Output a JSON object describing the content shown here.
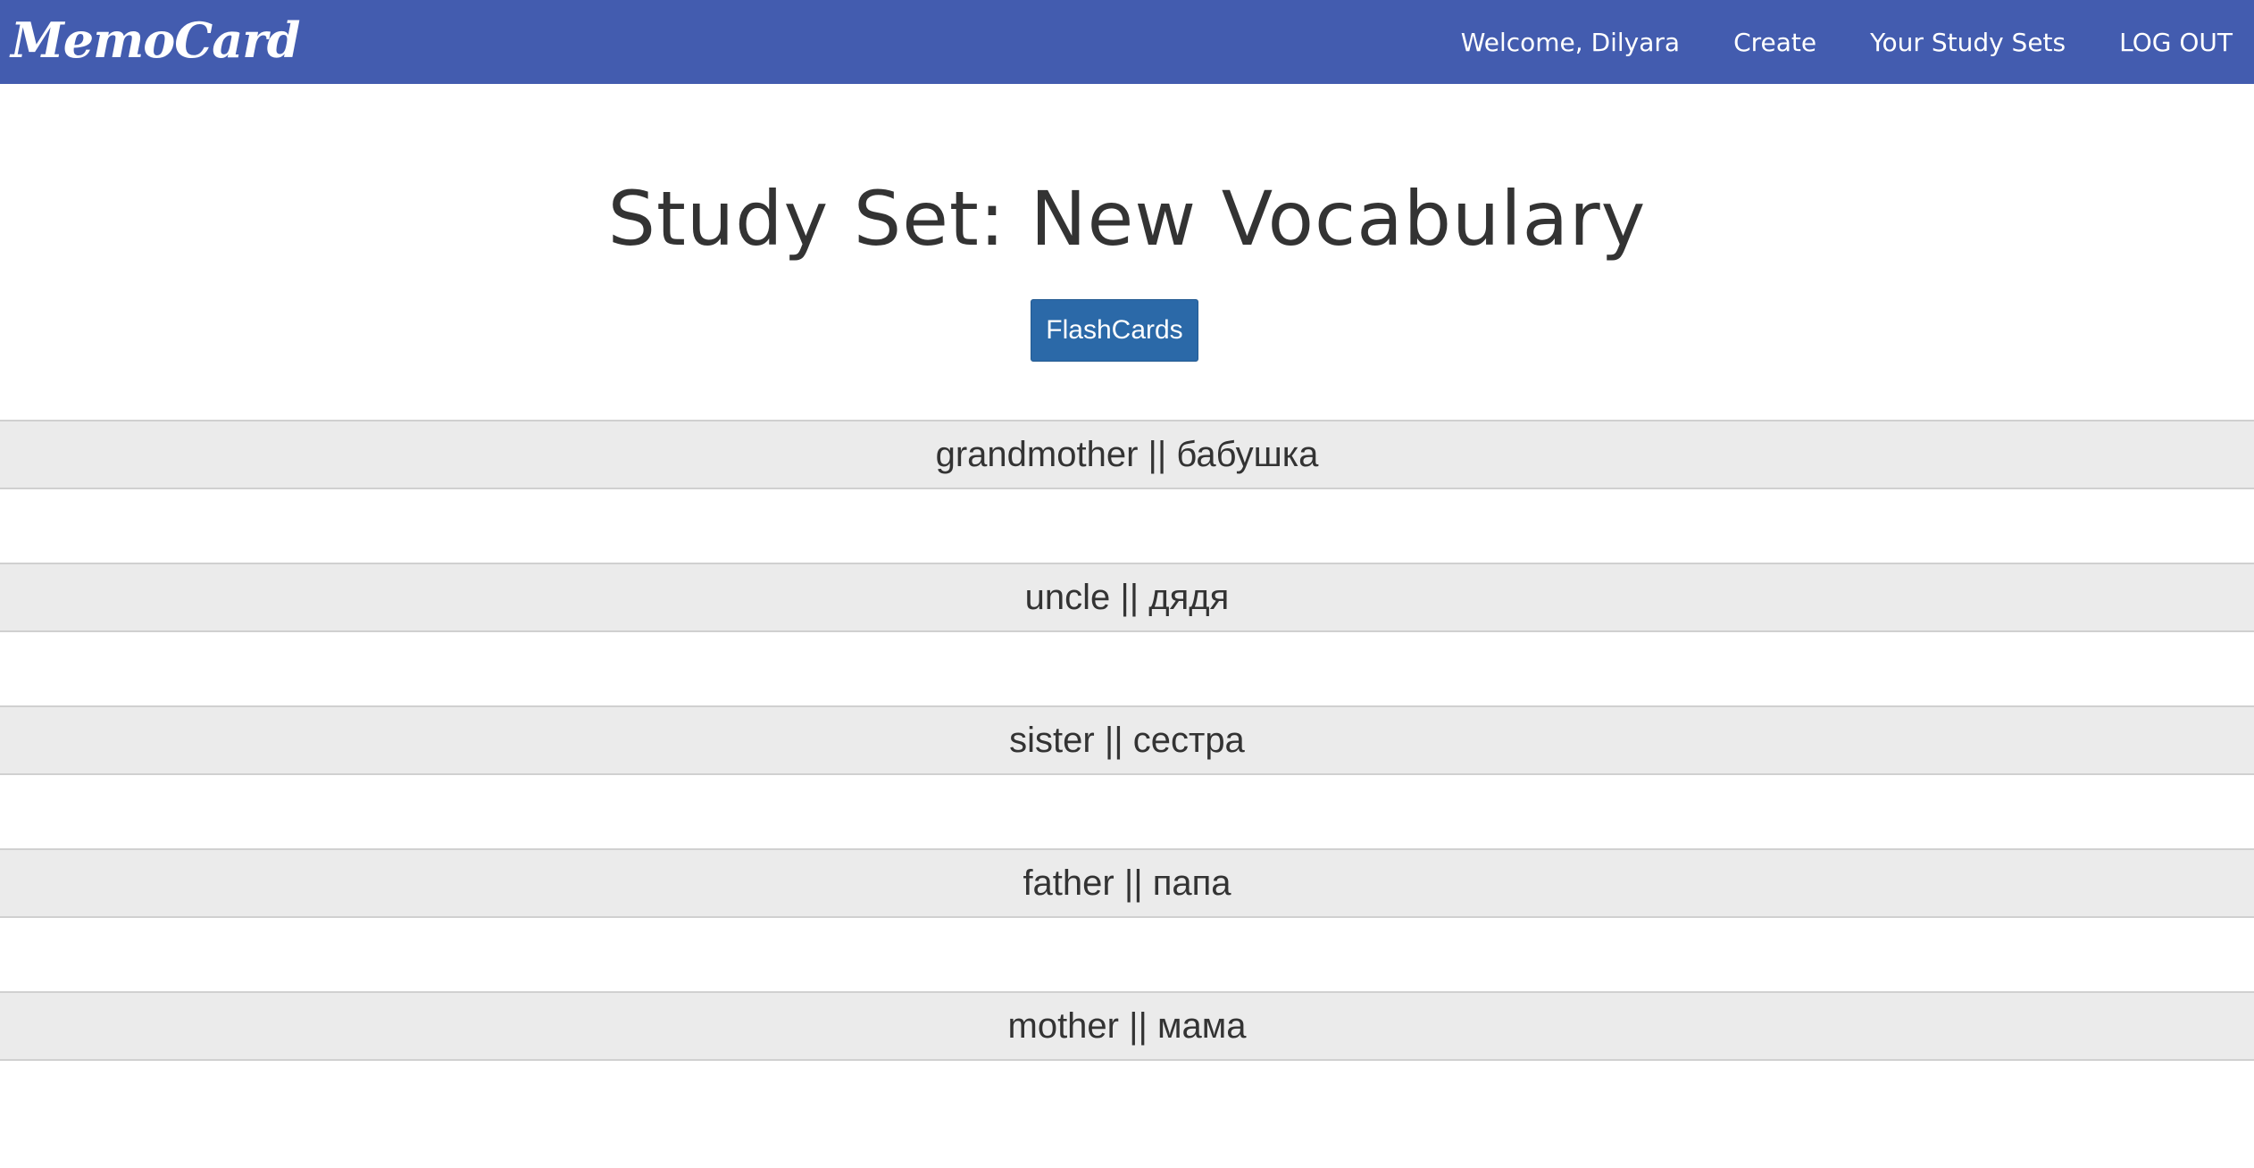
{
  "navbar": {
    "brand": "MemoCard",
    "links": [
      {
        "label": "Welcome, Dilyara"
      },
      {
        "label": "Create"
      },
      {
        "label": "Your Study Sets"
      },
      {
        "label": "LOG OUT"
      }
    ],
    "background_color": "#435caf"
  },
  "main": {
    "title": "Study Set: New Vocabulary",
    "flashcards_button": "FlashCards",
    "button_color": "#2b69a8",
    "cards": [
      {
        "text": "grandmother || бабушка"
      },
      {
        "text": "uncle || дядя"
      },
      {
        "text": "sister || сестра"
      },
      {
        "text": "father || папа"
      },
      {
        "text": "mother || мама"
      }
    ]
  }
}
